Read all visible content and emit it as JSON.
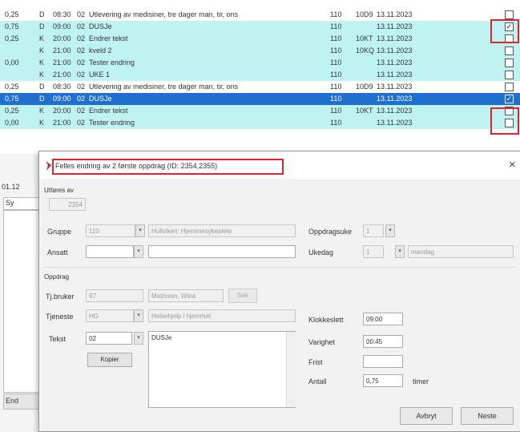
{
  "grid": {
    "rows": [
      {
        "style": "white",
        "amount": "0,25",
        "type": "D",
        "time": "08:30",
        "code": "02",
        "desc": "Utlevering av medisiner, tre dager man, tir, ons",
        "group": "110",
        "ref": "10D9",
        "date": "13.11.2023",
        "checked": false
      },
      {
        "style": "cyan",
        "amount": "0,75",
        "type": "D",
        "time": "09:00",
        "code": "02",
        "desc": "DUSJe",
        "group": "110",
        "ref": "",
        "date": "13.11.2023",
        "checked": true
      },
      {
        "style": "cyan",
        "amount": "0,25",
        "type": "K",
        "time": "20:00",
        "code": "02",
        "desc": "Endrer tekst",
        "group": "110",
        "ref": "10KT",
        "date": "13.11.2023",
        "checked": false
      },
      {
        "style": "cyan",
        "amount": "",
        "type": "K",
        "time": "21:00",
        "code": "02",
        "desc": "kveld 2",
        "group": "110",
        "ref": "10KQ",
        "date": "13.11.2023",
        "checked": false
      },
      {
        "style": "cyan",
        "amount": "0,00",
        "type": "K",
        "time": "21:00",
        "code": "02",
        "desc": "Tester endring",
        "group": "110",
        "ref": "",
        "date": "13.11.2023",
        "checked": false
      },
      {
        "style": "cyan",
        "amount": "",
        "type": "K",
        "time": "21:00",
        "code": "02",
        "desc": "UKE 1",
        "group": "110",
        "ref": "",
        "date": "13.11.2023",
        "checked": false
      },
      {
        "style": "white",
        "amount": "0,25",
        "type": "D",
        "time": "08:30",
        "code": "02",
        "desc": "Utlevering av medisiner, tre dager man, tir, ons",
        "group": "110",
        "ref": "10D9",
        "date": "13.11.2023",
        "checked": false
      },
      {
        "style": "sel",
        "amount": "0,75",
        "type": "D",
        "time": "09:00",
        "code": "02",
        "desc": "DUSJe",
        "group": "110",
        "ref": "",
        "date": "13.11.2023",
        "checked": true
      },
      {
        "style": "cyan",
        "amount": "0,25",
        "type": "K",
        "time": "20:00",
        "code": "02",
        "desc": "Endrer tekst",
        "group": "110",
        "ref": "10KT",
        "date": "13.11.2023",
        "checked": false
      },
      {
        "style": "cyan",
        "amount": "0,00",
        "type": "K",
        "time": "21:00",
        "code": "02",
        "desc": "Tester endring",
        "group": "110",
        "ref": "",
        "date": "13.11.2023",
        "checked": false
      }
    ]
  },
  "left": {
    "date_fragment": "01.12",
    "col_fragment": "Sy",
    "btn_fragment": "End"
  },
  "dialog": {
    "title": "Felles endring av 2 første oppdrag (ID: 2354,2355)",
    "close": "×",
    "section_utfores": "Utføres av",
    "id_value": "2354",
    "gruppe_label": "Gruppe",
    "gruppe_value": "110",
    "gruppe_name": "Hullvikeri: Hjemmesykepleie",
    "oppdragsuke_label": "Oppdragsuke",
    "oppdragsuke_value": "1",
    "ansatt_label": "Ansatt",
    "ansatt_value": "",
    "ansatt_name": "",
    "ukedag_label": "Ukedag",
    "ukedag_value": "1",
    "ukedag_name": "mandag",
    "section_oppdrag": "Oppdrag",
    "tjbruker_label": "Tj.bruker",
    "tjbruker_value": "97",
    "tjbruker_name": "Mathisen, Wina",
    "tjbruker_btn": "Søk",
    "tjeneste_label": "Tjeneste",
    "tjeneste_value": "HG",
    "tjeneste_name": "Helsehjelp i hjemmet",
    "tekst_label": "Tekst",
    "tekst_value": "02",
    "tekst_content": "DUSJe",
    "kopier_btn": "Kopier",
    "klokkeslett_label": "Klokkeslett",
    "klokkeslett_value": "09:00",
    "varighet_label": "Varighet",
    "varighet_value": "00:45",
    "frist_label": "Frist",
    "frist_value": "",
    "antall_label": "Antall",
    "antall_value": "0,75",
    "antall_unit": "timer",
    "avbryt_btn": "Avbryt",
    "neste_btn": "Neste"
  },
  "colors": {
    "cyan_row": "#bff3f2",
    "selected_row": "#1e6fcf",
    "highlight": "#d9252b",
    "logo": "#c8202a"
  }
}
